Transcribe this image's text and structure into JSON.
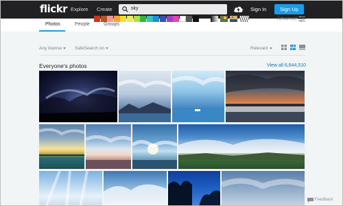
{
  "header": {
    "logo": "flickr",
    "nav": [
      "Explore",
      "Create"
    ],
    "search_value": "sky",
    "signin": "Sign In",
    "signup": "Sign Up"
  },
  "tabs": [
    "Photos",
    "People",
    "Groups"
  ],
  "active_tab": "Photos",
  "colors": {
    "topbar": "#212124",
    "accent": "#1c9be9",
    "link": "#1c6fb8"
  },
  "color_swatches": [
    "#e02d1c",
    "#b5541f",
    "#e99999",
    "#f69f33",
    "#f5e31a",
    "#ecec5c",
    "#b0e23c",
    "#38b43a",
    "#37c2c1",
    "#1a8fde",
    "#2f55bb",
    "#9b43c3",
    "#e045b3",
    "#ffffff",
    "#555555",
    "#111111"
  ],
  "pattern_filters": [
    "black-and-white-filter-icon",
    "shallow-depth-filter-icon",
    "minimalist-filter-icon",
    "patterns-filter-icon"
  ],
  "advanced_label": "Advanced",
  "filters": {
    "license": "Any license",
    "safesearch": "SafeSearch on",
    "sort": "Relevant"
  },
  "section": {
    "title": "Everyone's photos",
    "view_all": "View all 6,644,510"
  },
  "feedback": "Feedback"
}
